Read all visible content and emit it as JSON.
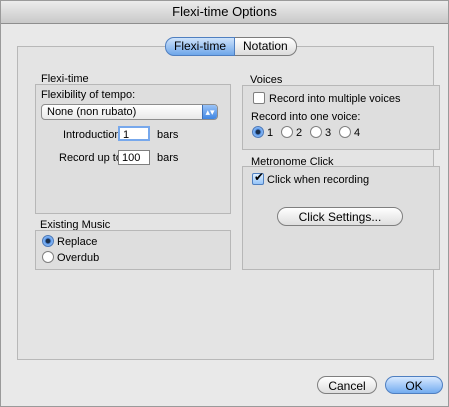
{
  "window": {
    "title": "Flexi-time Options"
  },
  "tabs": {
    "flexi_time": "Flexi-time",
    "notation": "Notation"
  },
  "flexi_time_section": {
    "heading": "Flexi-time",
    "flexibility_label": "Flexibility of tempo:",
    "flexibility_value": "None (non rubato)",
    "introduction_label": "Introduction",
    "introduction_value": "1",
    "introduction_unit": "bars",
    "record_up_to_label": "Record up to",
    "record_up_to_value": "100",
    "record_up_to_unit": "bars"
  },
  "voices_section": {
    "heading": "Voices",
    "multiple_voices_label": "Record into multiple voices",
    "multiple_voices_checked": false,
    "one_voice_label": "Record into one voice:",
    "voice_options": [
      "1",
      "2",
      "3",
      "4"
    ],
    "selected_voice": "1"
  },
  "metronome_section": {
    "heading": "Metronome Click",
    "click_when_recording_label": "Click when recording",
    "click_when_recording_checked": true,
    "click_settings_button": "Click Settings..."
  },
  "existing_music_section": {
    "heading": "Existing Music",
    "options": [
      "Replace",
      "Overdub"
    ],
    "selected": "Replace"
  },
  "footer": {
    "cancel": "Cancel",
    "ok": "OK"
  }
}
